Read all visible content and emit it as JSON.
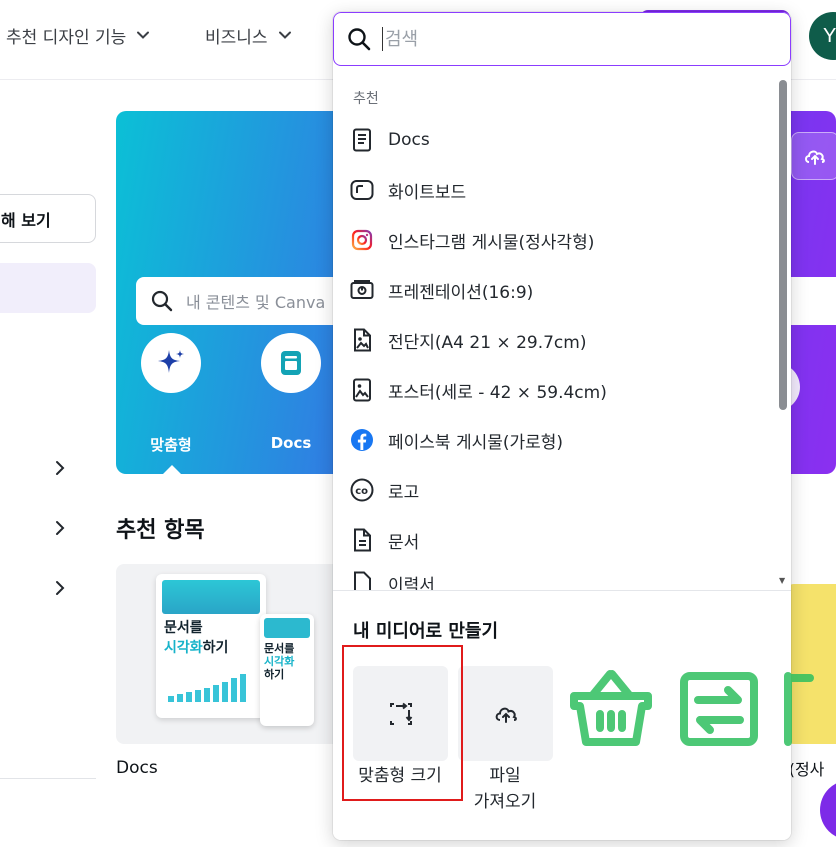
{
  "nav": {
    "item1": "추천 디자인 기능",
    "item2": "비즈니스",
    "avatar_initial": "Y"
  },
  "sidebar": {
    "button_label": "해 보기"
  },
  "hero": {
    "search_placeholder": "내 콘텐츠 및 Canva",
    "icons": [
      {
        "label": "맞춤형",
        "icon": "sparkle-icon"
      },
      {
        "label": "Docs",
        "icon": "docs-icon"
      }
    ]
  },
  "recommended": {
    "title": "추천 항목",
    "card_label": "Docs",
    "right_card_label": "물(정사",
    "thumbnail": {
      "line1": "문서를",
      "line2": "시각화",
      "line3": "하기",
      "small_line1": "문서를",
      "small_line2": "시각화",
      "small_line3": "하기"
    }
  },
  "search": {
    "placeholder": "검색",
    "value": "",
    "section_label": "추천",
    "items": [
      {
        "label": "Docs",
        "icon": "docs-icon"
      },
      {
        "label": "화이트보드",
        "icon": "whiteboard-icon"
      },
      {
        "label": "인스타그램 게시물(정사각형)",
        "icon": "instagram-icon"
      },
      {
        "label": "프레젠테이션(16:9)",
        "icon": "presentation-icon"
      },
      {
        "label": "전단지(A4 21 × 29.7cm)",
        "icon": "flyer-icon"
      },
      {
        "label": "포스터(세로 - 42 × 59.4cm)",
        "icon": "poster-icon"
      },
      {
        "label": "페이스북 게시물(가로형)",
        "icon": "facebook-icon"
      },
      {
        "label": "로고",
        "icon": "logo-icon"
      },
      {
        "label": "문서",
        "icon": "document-icon"
      },
      {
        "label": "이력서",
        "icon": "resume-icon"
      }
    ]
  },
  "media": {
    "title": "내 미디어로 만들기",
    "tiles": [
      {
        "label": "맞춤형 크기",
        "icon": "resize-icon"
      },
      {
        "label_line1": "파일",
        "label_line2": "가져오기",
        "icon": "cloud-upload-icon"
      }
    ]
  },
  "colors": {
    "accent": "#8b3dff",
    "highlight": "#e01b1b",
    "watermark": "#2fbf5f"
  }
}
